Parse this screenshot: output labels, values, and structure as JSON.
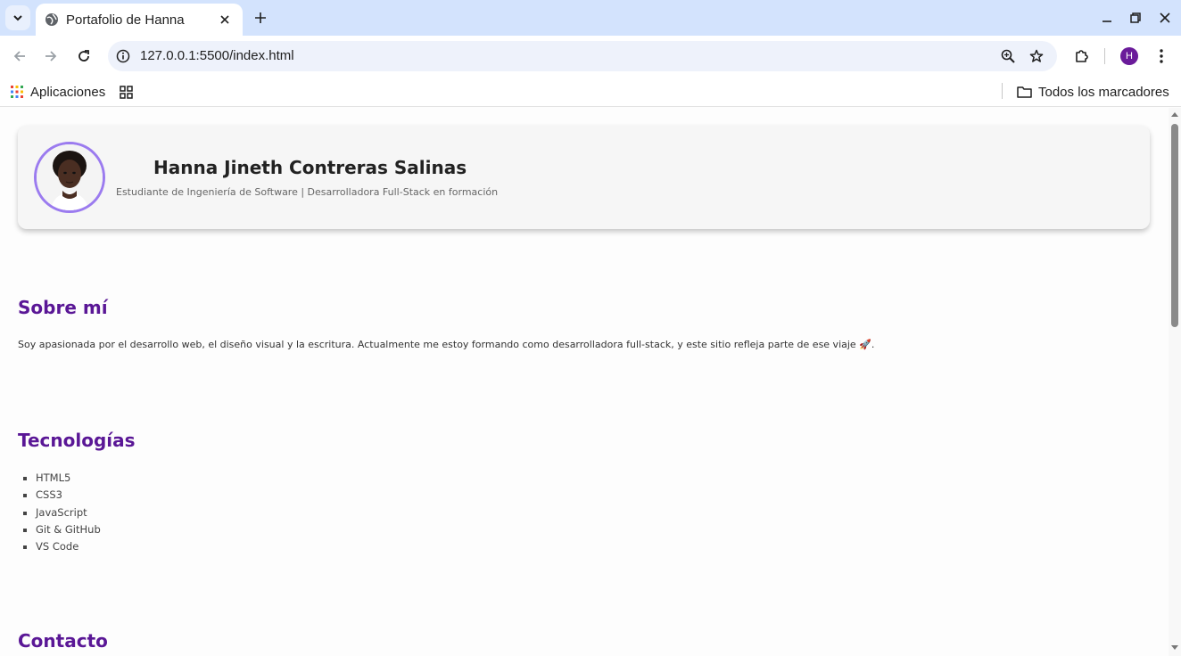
{
  "browser": {
    "tab_title": "Portafolio de Hanna",
    "url": "127.0.0.1:5500/index.html",
    "avatar_letter": "H",
    "bookmarks": {
      "apps_label": "Aplicaciones",
      "all_bookmarks_label": "Todos los marcadores"
    }
  },
  "page": {
    "header": {
      "name": "Hanna Jineth Contreras Salinas",
      "tagline": "Estudiante de Ingeniería de Software | Desarrolladora Full-Stack en formación"
    },
    "about": {
      "title": "Sobre mí",
      "text": "Soy apasionada por el desarrollo web, el diseño visual y la escritura. Actualmente me estoy formando como desarrolladora full-stack, y este sitio refleja parte de ese viaje 🚀."
    },
    "tech": {
      "title": "Tecnologías",
      "items": [
        "HTML5",
        "CSS3",
        "JavaScript",
        "Git & GitHub",
        "VS Code"
      ]
    },
    "contact": {
      "title": "Contacto"
    }
  },
  "colors": {
    "accent": "#5a1796",
    "photo_border": "#9b7bef",
    "tabstrip": "#d3e3fd"
  }
}
